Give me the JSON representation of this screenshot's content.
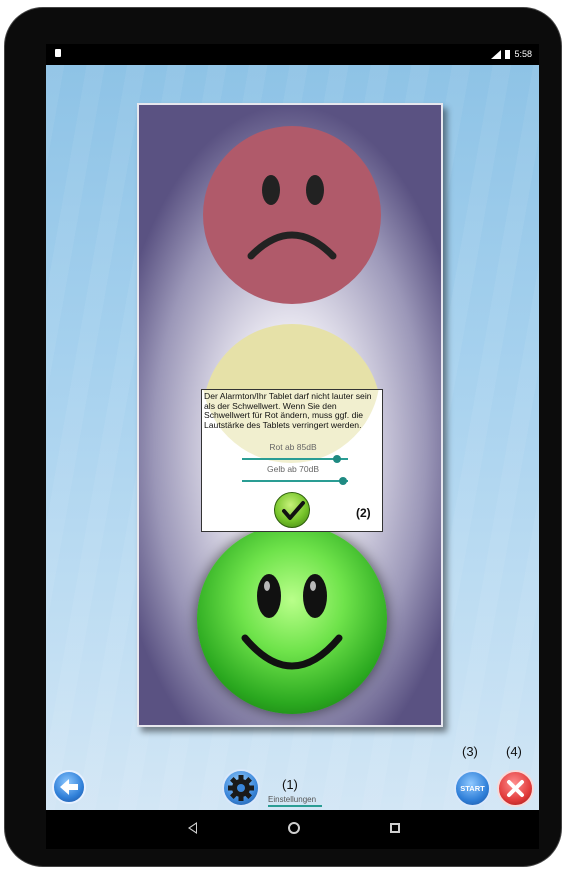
{
  "status_bar": {
    "time": "5:58"
  },
  "dialog": {
    "text": "Der Alarmton/Ihr Tablet darf nicht lauter sein als der Schwellwert. Wenn Sie den Schwellwert für Rot ändern, muss ggf. die Lautstärke des Tablets verringert werden.",
    "red_label": "Rot ab 85dB",
    "red_level": 0.9,
    "yellow_label": "Gelb ab 70dB",
    "yellow_level": 0.95,
    "marker": "(2)"
  },
  "bottom_bar": {
    "settings_marker": "(1)",
    "settings_label": "Einstellungen",
    "start_marker": "(3)",
    "start_label": "START",
    "close_marker": "(4)"
  },
  "icons": {
    "back": "back-arrow-icon",
    "settings": "gear-icon",
    "close": "close-x-icon",
    "check": "checkmark-icon"
  }
}
